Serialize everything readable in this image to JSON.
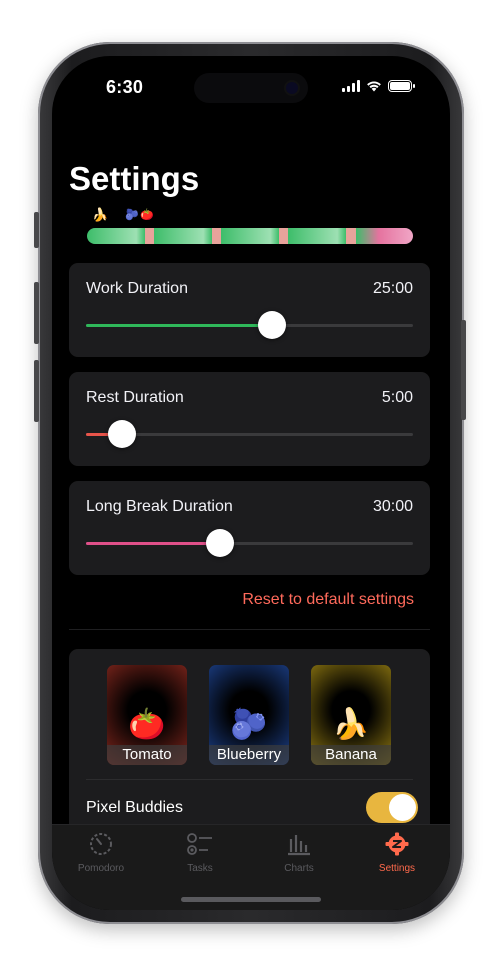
{
  "status_bar": {
    "time": "6:30"
  },
  "title": "Settings",
  "timeline": {
    "segments": [
      {
        "kind": "work",
        "color": "#3dbd6a",
        "flex": 60
      },
      {
        "kind": "rest",
        "color": "#e8a39b",
        "flex": 10
      },
      {
        "kind": "work",
        "color": "#3dbd6a",
        "flex": 60
      },
      {
        "kind": "rest",
        "color": "#e8a39b",
        "flex": 10
      },
      {
        "kind": "work",
        "color": "#3dbd6a",
        "flex": 60
      },
      {
        "kind": "rest",
        "color": "#e8a39b",
        "flex": 10
      },
      {
        "kind": "work",
        "color": "#3dbd6a",
        "flex": 60
      },
      {
        "kind": "rest",
        "color": "#e8a39b",
        "flex": 10
      },
      {
        "kind": "long_break",
        "color": "#e5739f",
        "flex": 60
      }
    ]
  },
  "settings": {
    "work": {
      "label": "Work Duration",
      "value": "25:00",
      "level": 0.57,
      "color": "#2fb85a"
    },
    "rest": {
      "label": "Rest Duration",
      "value": "5:00",
      "level": 0.11,
      "color": "#e8544a"
    },
    "long_break": {
      "label": "Long Break Duration",
      "value": "30:00",
      "level": 0.41,
      "color": "#e0508a"
    }
  },
  "reset_label": "Reset to default settings",
  "buddies": [
    {
      "name": "Tomato",
      "icon": "tomato-icon",
      "glyph": "🍅",
      "glow": "#c0392b"
    },
    {
      "name": "Blueberry",
      "icon": "blueberry-icon",
      "glyph": "🫐",
      "glow": "#2a5fcc"
    },
    {
      "name": "Banana",
      "icon": "banana-icon",
      "glyph": "🍌",
      "glow": "#d4b21a"
    }
  ],
  "pixel_buddies": {
    "label": "Pixel Buddies",
    "enabled": true,
    "color": "#e8b63f"
  },
  "tabs": [
    {
      "label": "Pomodoro",
      "icon": "timer-icon",
      "active": false
    },
    {
      "label": "Tasks",
      "icon": "checklist-icon",
      "active": false
    },
    {
      "label": "Charts",
      "icon": "bar-chart-icon",
      "active": false
    },
    {
      "label": "Settings",
      "icon": "gear-icon",
      "active": true
    }
  ],
  "colors": {
    "accent": "#ff6a4c",
    "background": "#000000",
    "card": "#1c1c1e"
  }
}
